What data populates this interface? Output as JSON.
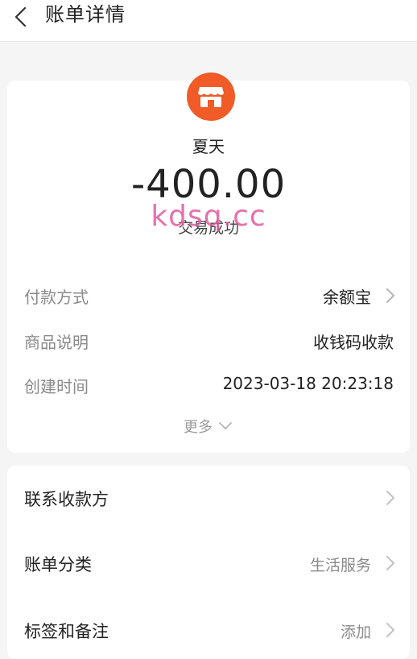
{
  "header": {
    "title": "账单详情",
    "back_icon": "chevron-left-icon"
  },
  "summary": {
    "merchant_name": "夏天",
    "merchant_icon": "store-icon",
    "avatar_color": "#f05b27",
    "amount": "-400.00",
    "status": "交易成功",
    "watermark": "kdsq.cc"
  },
  "details": [
    {
      "label": "付款方式",
      "value": "余额宝",
      "has_chevron": true
    },
    {
      "label": "商品说明",
      "value": "收钱码收款",
      "has_chevron": false
    },
    {
      "label": "创建时间",
      "value": "2023-03-18 20:23:18",
      "has_chevron": false
    }
  ],
  "more": {
    "label": "更多"
  },
  "options": [
    {
      "label": "联系收款方",
      "value": ""
    },
    {
      "label": "账单分类",
      "value": "生活服务"
    },
    {
      "label": "标签和备注",
      "value": "添加"
    }
  ]
}
